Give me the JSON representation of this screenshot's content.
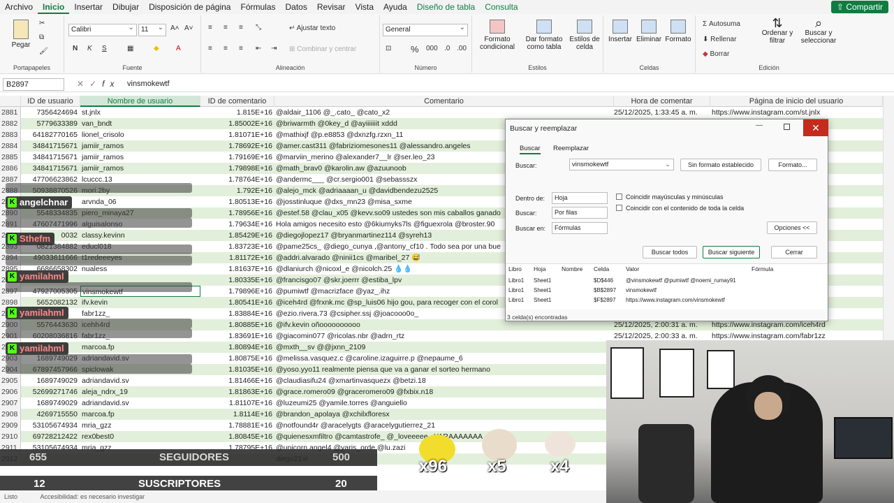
{
  "ribbon_tabs": [
    "Archivo",
    "Inicio",
    "Insertar",
    "Dibujar",
    "Disposición de página",
    "Fórmulas",
    "Datos",
    "Revisar",
    "Vista",
    "Ayuda",
    "Diseño de tabla",
    "Consulta"
  ],
  "share_label": "Compartir",
  "ribbon": {
    "clipboard": {
      "paste": "Pegar",
      "label": "Portapapeles"
    },
    "font": {
      "name": "Calibri",
      "size": "11",
      "label": "Fuente"
    },
    "alignment": {
      "wrap": "Ajustar texto",
      "merge": "Combinar y centrar",
      "label": "Alineación"
    },
    "number": {
      "format": "General",
      "label": "Número"
    },
    "styles": {
      "conditional": "Formato condicional",
      "table": "Dar formato como tabla",
      "cell": "Estilos de celda",
      "label": "Estilos"
    },
    "cells": {
      "insert": "Insertar",
      "delete": "Eliminar",
      "format": "Formato",
      "label": "Celdas"
    },
    "editing": {
      "autosum": "Autosuma",
      "fill": "Rellenar",
      "clear": "Borrar",
      "sort": "Ordenar y filtrar",
      "find": "Buscar y seleccionar",
      "label": "Edición"
    }
  },
  "formula_bar": {
    "cell": "B2897",
    "value": "vinsmokewtf"
  },
  "columns": [
    "ID de usuario",
    "Nombre de usuario",
    "ID de comentario",
    "Comentario",
    "Hora de comentar",
    "Página de inicio del usuario"
  ],
  "rows": [
    {
      "n": "2881",
      "id": "7356424694",
      "user": "st.jnlx",
      "cid": "1.815E+16",
      "comment": "@aldair_1106 @_.cato_ @cato_x2",
      "time": "25/12/2025, 1:33:45 a. m.",
      "page": "https://www.instagram.com/st.jnlx"
    },
    {
      "n": "2882",
      "id": "5779633389",
      "user": "van_bndt",
      "cid": "1.85002E+16",
      "comment": "@briwarmth @0key_d @ayiiiiiiit xddd",
      "time": "",
      "page": "ondt"
    },
    {
      "n": "2883",
      "id": "64182770165",
      "user": "lionel_crisolo",
      "cid": "1.81071E+16",
      "comment": "@mathixjf @p.e8853 @dxnzfg.rzxn_11",
      "time": "",
      "page": "_crisolo"
    },
    {
      "n": "2884",
      "id": "34841715671",
      "user": "jamiir_ramos",
      "cid": "1.78692E+16",
      "comment": "@amer.cast311 @fabriziomesones11 @alessandro.angeles",
      "time": "",
      "page": "_ramos"
    },
    {
      "n": "2885",
      "id": "34841715671",
      "user": "jamiir_ramos",
      "cid": "1.79169E+16",
      "comment": "@marviin_merino @alexander7__lr @ser.leo_23",
      "time": "",
      "page": "_ramos"
    },
    {
      "n": "2886",
      "id": "34841715671",
      "user": "jamiir_ramos",
      "cid": "1.79898E+16",
      "comment": "@math_brav0 @karolin.aw @azuunoob",
      "time": "",
      "page": "_ramos"
    },
    {
      "n": "2887",
      "id": "47706623862",
      "user": "lcuccc.13",
      "cid": "1.78764E+16",
      "comment": "@andermc___ @cr.sergio001 @sebassszx",
      "time": "",
      "page": "cc.13"
    },
    {
      "n": "2888",
      "id": "50938870526",
      "user": "mori.2by",
      "cid": "1.792E+16",
      "comment": "@alejo_mck @adriaaaan_u @davidbendezu2525",
      "time": "",
      "page": "2by"
    },
    {
      "n": "2889",
      "id": "",
      "user": "arvnda_06",
      "cid": "1.80513E+16",
      "comment": "@josstinluque @dxs_mn23 @misa_sxme",
      "time": "",
      "page": "nda_06"
    },
    {
      "n": "2890",
      "id": "5548334835",
      "user": "piero_minaya27",
      "cid": "1.78956E+16",
      "comment": "@estef.58 @clau_x05 @kevv.so09 ustedes son mis caballos ganado",
      "time": "",
      "page": "_minaya27"
    },
    {
      "n": "2891",
      "id": "47607471996",
      "user": "alguisalonso",
      "cid": "1.79634E+16",
      "comment": "Hola amigos necesito esto @6kiumyks7ls @figuexrola @broster.90",
      "time": "",
      "page": "salonso"
    },
    {
      "n": "2892",
      "id": "0032",
      "user": "classy.kevinn",
      "cid": "1.85429E+16",
      "comment": "@diegojlopez17 @bryanmartinez114 @syreh13",
      "time": "",
      "page": "y.kevinn"
    },
    {
      "n": "2893",
      "id": "0821384882",
      "user": "educl018",
      "cid": "1.83723E+16",
      "comment": "@pame25cs_ @diego_cunya ,@antony_cf10 . Todo sea por una bue",
      "time": "",
      "page": "018"
    },
    {
      "n": "2894",
      "id": "49033611666",
      "user": "t1redeeeyes",
      "cid": "1.81172E+16",
      "comment": "@addri.alvarado @ninii1cs @maribel_27 😅",
      "time": "",
      "page": "eeeyes"
    },
    {
      "n": "2895",
      "id": "6686658302",
      "user": "nualess",
      "cid": "1.81637E+16",
      "comment": "@dlaniurch @nicoxl_e @nicolch.25 💧💧",
      "time": "",
      "page": "ess"
    },
    {
      "n": "2896",
      "id": "",
      "user": "",
      "cid": "1.80335E+16",
      "comment": "@francisgo07 @skr.joerrr @estiba_lpv",
      "time": "",
      "page": "skylled"
    },
    {
      "n": "2897",
      "id": "47927005305",
      "user": "vinsmokewtf",
      "cid": "1.79896E+16",
      "comment": "@pumiwtf @macrizface @yaz_.ihz",
      "time": "",
      "page": "nokewtf"
    },
    {
      "n": "2898",
      "id": "5652082132",
      "user": "ifv.kevin",
      "cid": "1.80541E+16",
      "comment": "@iceh4rd @frxnk.mc @sp_luis06 hijo gou, para recoger con el corol",
      "time": "",
      "page": "evin"
    },
    {
      "n": "2899",
      "id": "",
      "user": "fabr1zz_",
      "cid": "1.83884E+16",
      "comment": "@ezio.rivera.73 @csipher.ssj @joacooo0o_",
      "time": "",
      "page": "1zz_"
    },
    {
      "n": "2900",
      "id": "5576443630",
      "user": "icehh4rd",
      "cid": "1.80885E+16",
      "comment": "@ifv.kevin oñoooooooooo",
      "time": "25/12/2025, 2:00:31 a. m.",
      "page": "https://www.instagram.com/iceh4rd"
    },
    {
      "n": "2901",
      "id": "60208036816",
      "user": "fabr1zz_",
      "cid": "1.83691E+16",
      "comment": "@giacomin077 @ricolas.nbr @adrn_rtz",
      "time": "25/12/2025, 2:00:33 a. m.",
      "page": "https://www.instagram.com/fabr1zz"
    },
    {
      "n": "2902",
      "id": "",
      "user": "marcoa.fp",
      "cid": "1.80894E+16",
      "comment": "@mxth__sv @@jxnn_2109",
      "time": "",
      "page": ""
    },
    {
      "n": "2903",
      "id": "1689749029",
      "user": "adriandavid.sv",
      "cid": "1.80875E+16",
      "comment": "@melissa.vasquez.c @caroline.izaguirre.p @nepaume_6",
      "time": "",
      "page": ""
    },
    {
      "n": "2904",
      "id": "67897457966",
      "user": "spiclowak",
      "cid": "1.81035E+16",
      "comment": "@yoso.yyo11 realmente piensa que va a ganar el sorteo hermano",
      "time": "",
      "page": ""
    },
    {
      "n": "2905",
      "id": "1689749029",
      "user": "adriandavid.sv",
      "cid": "1.81466E+16",
      "comment": "@claudiasifu24 @xmartinvasquezx @betzi.18",
      "time": "",
      "page": ""
    },
    {
      "n": "2906",
      "id": "52699271746",
      "user": "aleja_ndrx_19",
      "cid": "1.81863E+16",
      "comment": "@grace.romero09 @graceromero09 @fxbix.n18",
      "time": "",
      "page": ""
    },
    {
      "n": "2907",
      "id": "1689749029",
      "user": "adriandavid.sv",
      "cid": "1.81107E+16",
      "comment": "@luzeumi25 @yamile.torres @anguiello",
      "time": "",
      "page": ""
    },
    {
      "n": "2908",
      "id": "4269715550",
      "user": "marcoa.fp",
      "cid": "1.8114E+16",
      "comment": "@brandon_apolaya @xchilxfloresx",
      "time": "",
      "page": ""
    },
    {
      "n": "2909",
      "id": "53105674934",
      "user": "mria_gzz",
      "cid": "1.78881E+16",
      "comment": "@notfound4r @aracelygts @aracelygutierrez_21",
      "time": "",
      "page": ""
    },
    {
      "n": "2910",
      "id": "69728212422",
      "user": "rex0best0",
      "cid": "1.80845E+16",
      "comment": "@quienesxmfiltro @camtastrofe_ @_loveeeee_ YARAAAAAAA",
      "time": "",
      "page": ""
    },
    {
      "n": "2911",
      "id": "53105674934",
      "user": "mria_gzz",
      "cid": "1.78795E+16",
      "comment": "@unicorn.angel4 @yaris_orde @lu.zazi",
      "time": "",
      "page": ""
    },
    {
      "n": "2912",
      "id": "",
      "user": "",
      "cid": "",
      "comment": "diego21vr",
      "time": "",
      "page": ""
    }
  ],
  "dialog": {
    "title": "Buscar y reemplazar",
    "tab_find": "Buscar",
    "tab_replace": "Reemplazar",
    "find_label": "Buscar:",
    "find_value": "vinsmokewtf",
    "no_format": "Sin formato establecido",
    "format": "Formato...",
    "within_label": "Dentro de:",
    "within_value": "Hoja",
    "search_label": "Buscar:",
    "search_value": "Por filas",
    "look_in_label": "Buscar en:",
    "look_in_value": "Fórmulas",
    "match_case": "Coincidir mayúsculas y minúsculas",
    "match_entire": "Coincidir con el contenido de toda la celda",
    "options": "Opciones <<",
    "find_all": "Buscar todos",
    "find_next": "Buscar siguiente",
    "close": "Cerrar",
    "results_headers": [
      "Libro",
      "Hoja",
      "Nombre",
      "Celda",
      "Valor",
      "Fórmula"
    ],
    "results": [
      {
        "book": "Libro1",
        "sheet": "Sheet1",
        "cell": "$D$446",
        "value": "@vinsmokewtf @pumiwtf @noemi_rumay91"
      },
      {
        "book": "Libro1",
        "sheet": "Sheet1",
        "cell": "$B$2897",
        "value": "vinsmokewtf"
      },
      {
        "book": "Libro1",
        "sheet": "Sheet1",
        "cell": "$F$2897",
        "value": "https://www.instagram.com/vinsmokewtf"
      }
    ],
    "status": "3 celda(s) encontradas"
  },
  "chat": [
    "angelchnar",
    "Sthefm",
    "yamilahml",
    "yamilahml",
    "yamilahml"
  ],
  "stream": {
    "followers_count": "655",
    "followers_label": "SEGUIDORES",
    "followers_goal": "500",
    "subs_count": "12",
    "subs_label": "SUSCRIPTORES",
    "subs_goal": "20",
    "emote_counts": [
      "x96",
      "x5",
      "x4"
    ]
  },
  "statusbar": {
    "left": "Listo",
    "accessibility": "Accesibilidad: es necesario investigar"
  }
}
